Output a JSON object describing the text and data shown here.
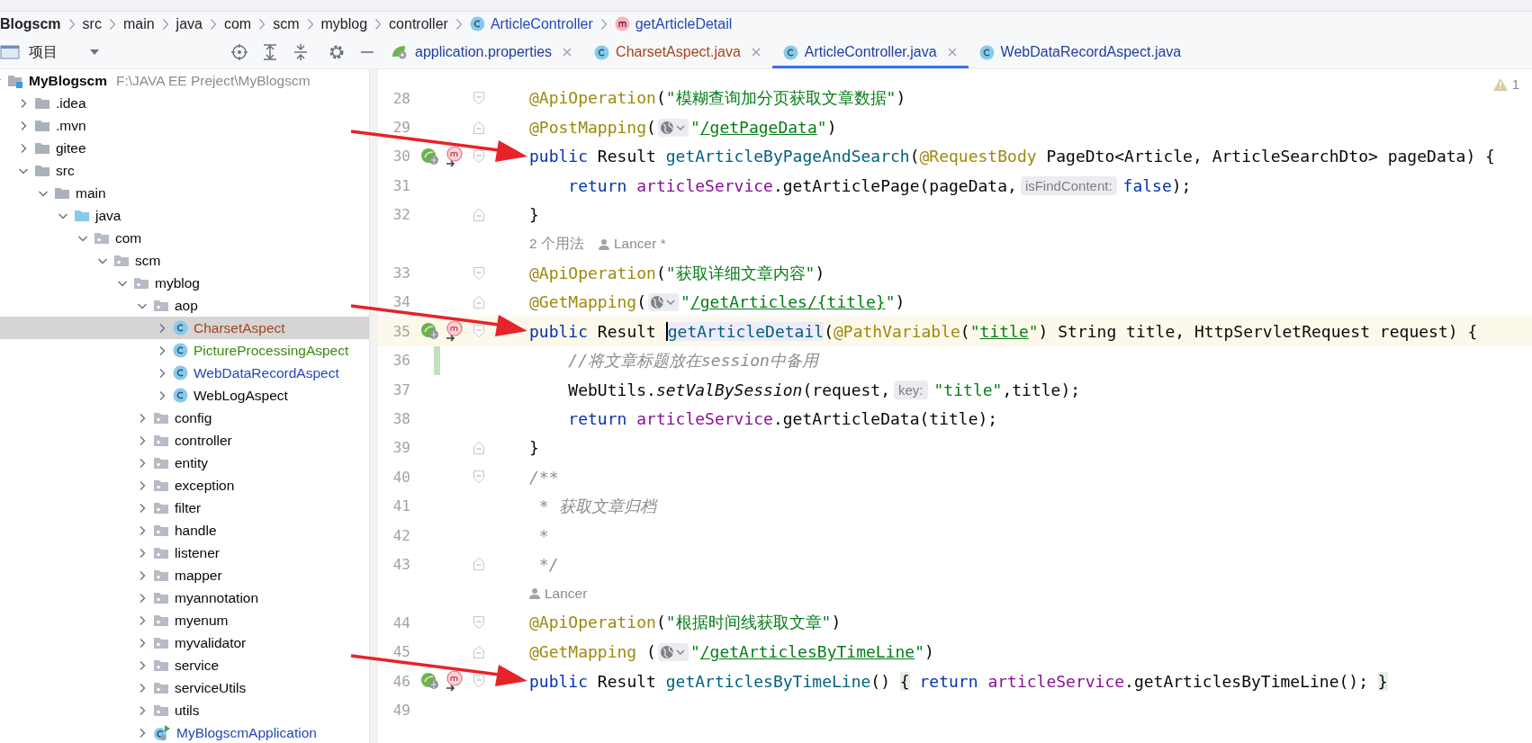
{
  "breadcrumb": [
    {
      "label": "Blogscm",
      "kind": "project"
    },
    {
      "label": "src",
      "kind": "folder"
    },
    {
      "label": "main",
      "kind": "folder"
    },
    {
      "label": "java",
      "kind": "folder"
    },
    {
      "label": "com",
      "kind": "folder"
    },
    {
      "label": "scm",
      "kind": "folder"
    },
    {
      "label": "myblog",
      "kind": "folder"
    },
    {
      "label": "controller",
      "kind": "folder"
    },
    {
      "label": "ArticleController",
      "kind": "class"
    },
    {
      "label": "getArticleDetail",
      "kind": "method"
    }
  ],
  "project_panel": {
    "title": "项目"
  },
  "tabs": [
    {
      "label": "application.properties",
      "kind": "properties",
      "color": "#1f3f9e",
      "selected": false,
      "closable": true
    },
    {
      "label": "CharsetAspect.java",
      "kind": "class",
      "color": "#a3461c",
      "selected": false,
      "closable": true
    },
    {
      "label": "ArticleController.java",
      "kind": "class",
      "color": "#1f3f9e",
      "selected": true,
      "closable": true
    },
    {
      "label": "WebDataRecordAspect.java",
      "kind": "class",
      "color": "#1f3f9e",
      "selected": false,
      "closable": false
    }
  ],
  "tree": [
    {
      "label": "MyBlogscm",
      "kind": "project",
      "path": "F:\\JAVA EE Preject\\MyBlogscm",
      "expanded": true,
      "selected": false,
      "children": [
        {
          "label": ".idea",
          "kind": "folder",
          "expanded": false,
          "selected": false
        },
        {
          "label": ".mvn",
          "kind": "folder",
          "expanded": false,
          "selected": false
        },
        {
          "label": "gitee",
          "kind": "folder",
          "expanded": false,
          "selected": false
        },
        {
          "label": "src",
          "kind": "folder",
          "expanded": true,
          "selected": false,
          "children": [
            {
              "label": "main",
              "kind": "folder",
              "expanded": true,
              "selected": false,
              "children": [
                {
                  "label": "java",
                  "kind": "source",
                  "expanded": true,
                  "selected": false,
                  "children": [
                    {
                      "label": "com",
                      "kind": "package",
                      "expanded": true,
                      "selected": false,
                      "children": [
                        {
                          "label": "scm",
                          "kind": "package",
                          "expanded": true,
                          "selected": false,
                          "children": [
                            {
                              "label": "myblog",
                              "kind": "package",
                              "expanded": true,
                              "selected": false,
                              "children": [
                                {
                                  "label": "aop",
                                  "kind": "package",
                                  "expanded": true,
                                  "selected": false,
                                  "children": [
                                    {
                                      "label": "CharsetAspect",
                                      "kind": "class",
                                      "color": "#a3461c",
                                      "expanded": false,
                                      "selected": true
                                    },
                                    {
                                      "label": "PictureProcessingAspect",
                                      "kind": "class",
                                      "color": "#3c8a0e",
                                      "expanded": false,
                                      "selected": false
                                    },
                                    {
                                      "label": "WebDataRecordAspect",
                                      "kind": "class",
                                      "color": "#2547b5",
                                      "expanded": false,
                                      "selected": false
                                    },
                                    {
                                      "label": "WebLogAspect",
                                      "kind": "class",
                                      "color": "#080808",
                                      "expanded": false,
                                      "selected": false
                                    }
                                  ]
                                },
                                {
                                  "label": "config",
                                  "kind": "package",
                                  "expanded": false,
                                  "selected": false
                                },
                                {
                                  "label": "controller",
                                  "kind": "package",
                                  "expanded": false,
                                  "selected": false
                                },
                                {
                                  "label": "entity",
                                  "kind": "package",
                                  "expanded": false,
                                  "selected": false
                                },
                                {
                                  "label": "exception",
                                  "kind": "package",
                                  "expanded": false,
                                  "selected": false
                                },
                                {
                                  "label": "filter",
                                  "kind": "package",
                                  "expanded": false,
                                  "selected": false
                                },
                                {
                                  "label": "handle",
                                  "kind": "package",
                                  "expanded": false,
                                  "selected": false
                                },
                                {
                                  "label": "listener",
                                  "kind": "package",
                                  "expanded": false,
                                  "selected": false
                                },
                                {
                                  "label": "mapper",
                                  "kind": "package",
                                  "expanded": false,
                                  "selected": false
                                },
                                {
                                  "label": "myannotation",
                                  "kind": "package",
                                  "expanded": false,
                                  "selected": false
                                },
                                {
                                  "label": "myenum",
                                  "kind": "package",
                                  "expanded": false,
                                  "selected": false
                                },
                                {
                                  "label": "myvalidator",
                                  "kind": "package",
                                  "expanded": false,
                                  "selected": false
                                },
                                {
                                  "label": "service",
                                  "kind": "package",
                                  "expanded": false,
                                  "selected": false
                                },
                                {
                                  "label": "serviceUtils",
                                  "kind": "package",
                                  "expanded": false,
                                  "selected": false
                                },
                                {
                                  "label": "utils",
                                  "kind": "package",
                                  "expanded": false,
                                  "selected": false
                                },
                                {
                                  "label": "MyBlogscmApplication",
                                  "kind": "app",
                                  "color": "#2547b5",
                                  "expanded": false,
                                  "selected": false
                                }
                              ]
                            }
                          ]
                        }
                      ]
                    }
                  ]
                }
              ]
            }
          ]
        }
      ]
    }
  ],
  "editor": {
    "warning_count": "1",
    "lines": [
      {
        "kind": "code",
        "number": "28",
        "fold_start": true,
        "fold_end": false,
        "current": false,
        "changed": false,
        "run_icons": false,
        "arrow": false,
        "tokens": [
          {
            "kind": "annotation",
            "text": "@ApiOperation"
          },
          {
            "kind": "plain",
            "text": "("
          },
          {
            "kind": "string",
            "text": "\"模糊查询加分页获取文章数据\""
          },
          {
            "kind": "plain",
            "text": ")"
          }
        ]
      },
      {
        "kind": "code",
        "number": "29",
        "fold_start": false,
        "fold_end": true,
        "current": false,
        "changed": false,
        "run_icons": false,
        "arrow": false,
        "tokens": [
          {
            "kind": "annotation",
            "text": "@PostMapping"
          },
          {
            "kind": "plain",
            "text": "("
          },
          {
            "kind": "globe"
          },
          {
            "kind": "string",
            "text": "\""
          },
          {
            "kind": "url",
            "text": "/getPageData"
          },
          {
            "kind": "string",
            "text": "\""
          },
          {
            "kind": "plain",
            "text": ")"
          }
        ]
      },
      {
        "kind": "code",
        "number": "30",
        "fold_start": true,
        "fold_end": false,
        "current": false,
        "changed": false,
        "run_icons": true,
        "arrow": true,
        "tokens": [
          {
            "kind": "keyword",
            "text": "public"
          },
          {
            "kind": "plain",
            "text": " Result "
          },
          {
            "kind": "method",
            "text": "getArticleByPageAndSearch"
          },
          {
            "kind": "plain",
            "text": "("
          },
          {
            "kind": "annotation",
            "text": "@RequestBody"
          },
          {
            "kind": "plain",
            "text": " PageDto<Article, ArticleSearchDto> pageData) {"
          }
        ]
      },
      {
        "kind": "code",
        "number": "31",
        "fold_start": false,
        "fold_end": false,
        "current": false,
        "changed": false,
        "run_icons": false,
        "arrow": false,
        "tokens": [
          {
            "kind": "indent"
          },
          {
            "kind": "keyword",
            "text": "return "
          },
          {
            "kind": "field",
            "text": "articleService"
          },
          {
            "kind": "plain",
            "text": ".getArticlePage(pageData,"
          },
          {
            "kind": "hint",
            "text": "isFindContent:"
          },
          {
            "kind": "keyword",
            "text": "false"
          },
          {
            "kind": "plain",
            "text": ");"
          }
        ]
      },
      {
        "kind": "code",
        "number": "32",
        "fold_start": false,
        "fold_end": true,
        "current": false,
        "changed": false,
        "run_icons": false,
        "arrow": false,
        "tokens": [
          {
            "kind": "plain",
            "text": "}"
          }
        ]
      },
      {
        "kind": "inlay",
        "items": [
          {
            "text": "2 个用法",
            "person": false
          },
          {
            "text": "Lancer *",
            "person": true
          }
        ]
      },
      {
        "kind": "code",
        "number": "33",
        "fold_start": true,
        "fold_end": false,
        "current": false,
        "changed": false,
        "run_icons": false,
        "arrow": false,
        "tokens": [
          {
            "kind": "annotation",
            "text": "@ApiOperation"
          },
          {
            "kind": "plain",
            "text": "("
          },
          {
            "kind": "string",
            "text": "\"获取详细文章内容\""
          },
          {
            "kind": "plain",
            "text": ")"
          }
        ]
      },
      {
        "kind": "code",
        "number": "34",
        "fold_start": false,
        "fold_end": true,
        "current": false,
        "changed": false,
        "run_icons": false,
        "arrow": false,
        "tokens": [
          {
            "kind": "annotation",
            "text": "@GetMapping"
          },
          {
            "kind": "plain",
            "text": "("
          },
          {
            "kind": "globe"
          },
          {
            "kind": "string",
            "text": "\""
          },
          {
            "kind": "url",
            "text": "/getArticles/{title}"
          },
          {
            "kind": "string",
            "text": "\""
          },
          {
            "kind": "plain",
            "text": ")"
          }
        ]
      },
      {
        "kind": "code",
        "number": "35",
        "fold_start": true,
        "fold_end": false,
        "current": true,
        "changed": false,
        "run_icons": true,
        "arrow": true,
        "tokens": [
          {
            "kind": "keyword",
            "text": "public"
          },
          {
            "kind": "plain",
            "text": " Result "
          },
          {
            "kind": "usage",
            "text": "getArticleDetail",
            "caret": true
          },
          {
            "kind": "plain",
            "text": "("
          },
          {
            "kind": "annotation",
            "text": "@PathVariable"
          },
          {
            "kind": "plain",
            "text": "("
          },
          {
            "kind": "string",
            "text": "\""
          },
          {
            "kind": "url",
            "text": "title"
          },
          {
            "kind": "string",
            "text": "\""
          },
          {
            "kind": "plain",
            "text": ") String title, HttpServletRequest request) {"
          }
        ]
      },
      {
        "kind": "code",
        "number": "36",
        "fold_start": false,
        "fold_end": false,
        "current": false,
        "changed": true,
        "run_icons": false,
        "arrow": false,
        "tokens": [
          {
            "kind": "indent"
          },
          {
            "kind": "comment",
            "text": "//将文章标题放在session中备用"
          }
        ]
      },
      {
        "kind": "code",
        "number": "37",
        "fold_start": false,
        "fold_end": false,
        "current": false,
        "changed": false,
        "run_icons": false,
        "arrow": false,
        "tokens": [
          {
            "kind": "indent"
          },
          {
            "kind": "plain",
            "text": "WebUtils."
          },
          {
            "kind": "static",
            "text": "setValBySession"
          },
          {
            "kind": "plain",
            "text": "(request,"
          },
          {
            "kind": "hint",
            "text": "key:"
          },
          {
            "kind": "string",
            "text": "\"title\""
          },
          {
            "kind": "plain",
            "text": ",title);"
          }
        ]
      },
      {
        "kind": "code",
        "number": "38",
        "fold_start": false,
        "fold_end": false,
        "current": false,
        "changed": false,
        "run_icons": false,
        "arrow": false,
        "tokens": [
          {
            "kind": "indent"
          },
          {
            "kind": "keyword",
            "text": "return "
          },
          {
            "kind": "field",
            "text": "articleService"
          },
          {
            "kind": "plain",
            "text": ".getArticleData(title);"
          }
        ]
      },
      {
        "kind": "code",
        "number": "39",
        "fold_start": false,
        "fold_end": true,
        "current": false,
        "changed": false,
        "run_icons": false,
        "arrow": false,
        "tokens": [
          {
            "kind": "plain",
            "text": "}"
          }
        ]
      },
      {
        "kind": "code",
        "number": "40",
        "fold_start": true,
        "fold_end": false,
        "current": false,
        "changed": false,
        "run_icons": false,
        "arrow": false,
        "tokens": [
          {
            "kind": "comment",
            "text": "/**"
          }
        ]
      },
      {
        "kind": "code",
        "number": "41",
        "fold_start": false,
        "fold_end": false,
        "current": false,
        "changed": false,
        "run_icons": false,
        "arrow": false,
        "tokens": [
          {
            "kind": "comment",
            "text": " * 获取文章归档"
          }
        ]
      },
      {
        "kind": "code",
        "number": "42",
        "fold_start": false,
        "fold_end": false,
        "current": false,
        "changed": false,
        "run_icons": false,
        "arrow": false,
        "tokens": [
          {
            "kind": "comment",
            "text": " *"
          }
        ]
      },
      {
        "kind": "code",
        "number": "43",
        "fold_start": false,
        "fold_end": true,
        "current": false,
        "changed": false,
        "run_icons": false,
        "arrow": false,
        "tokens": [
          {
            "kind": "comment",
            "text": " */"
          }
        ]
      },
      {
        "kind": "inlay",
        "items": [
          {
            "text": "Lancer",
            "person": true
          }
        ]
      },
      {
        "kind": "code",
        "number": "44",
        "fold_start": true,
        "fold_end": false,
        "current": false,
        "changed": false,
        "run_icons": false,
        "arrow": false,
        "tokens": [
          {
            "kind": "annotation",
            "text": "@ApiOperation"
          },
          {
            "kind": "plain",
            "text": "("
          },
          {
            "kind": "string",
            "text": "\"根据时间线获取文章\""
          },
          {
            "kind": "plain",
            "text": ")"
          }
        ]
      },
      {
        "kind": "code",
        "number": "45",
        "fold_start": false,
        "fold_end": true,
        "current": false,
        "changed": false,
        "run_icons": false,
        "arrow": false,
        "tokens": [
          {
            "kind": "annotation",
            "text": "@GetMapping"
          },
          {
            "kind": "plain",
            "text": " ("
          },
          {
            "kind": "globe"
          },
          {
            "kind": "string",
            "text": "\""
          },
          {
            "kind": "url",
            "text": "/getArticlesByTimeLine"
          },
          {
            "kind": "string",
            "text": "\""
          },
          {
            "kind": "plain",
            "text": ")"
          }
        ]
      },
      {
        "kind": "code",
        "number": "46",
        "fold_start": true,
        "fold_end": false,
        "current": false,
        "changed": false,
        "run_icons": true,
        "arrow": true,
        "tokens": [
          {
            "kind": "keyword",
            "text": "public"
          },
          {
            "kind": "plain",
            "text": " Result "
          },
          {
            "kind": "method",
            "text": "getArticlesByTimeLine"
          },
          {
            "kind": "plain",
            "text": "() "
          },
          {
            "kind": "match",
            "text": "{"
          },
          {
            "kind": "keyword",
            "text": " return "
          },
          {
            "kind": "field",
            "text": "articleService"
          },
          {
            "kind": "plain",
            "text": ".getArticlesByTimeLine(); "
          },
          {
            "kind": "match",
            "text": "}"
          }
        ]
      },
      {
        "kind": "code",
        "number": "49",
        "fold_start": false,
        "fold_end": false,
        "current": false,
        "changed": false,
        "run_icons": false,
        "arrow": false
      }
    ]
  }
}
